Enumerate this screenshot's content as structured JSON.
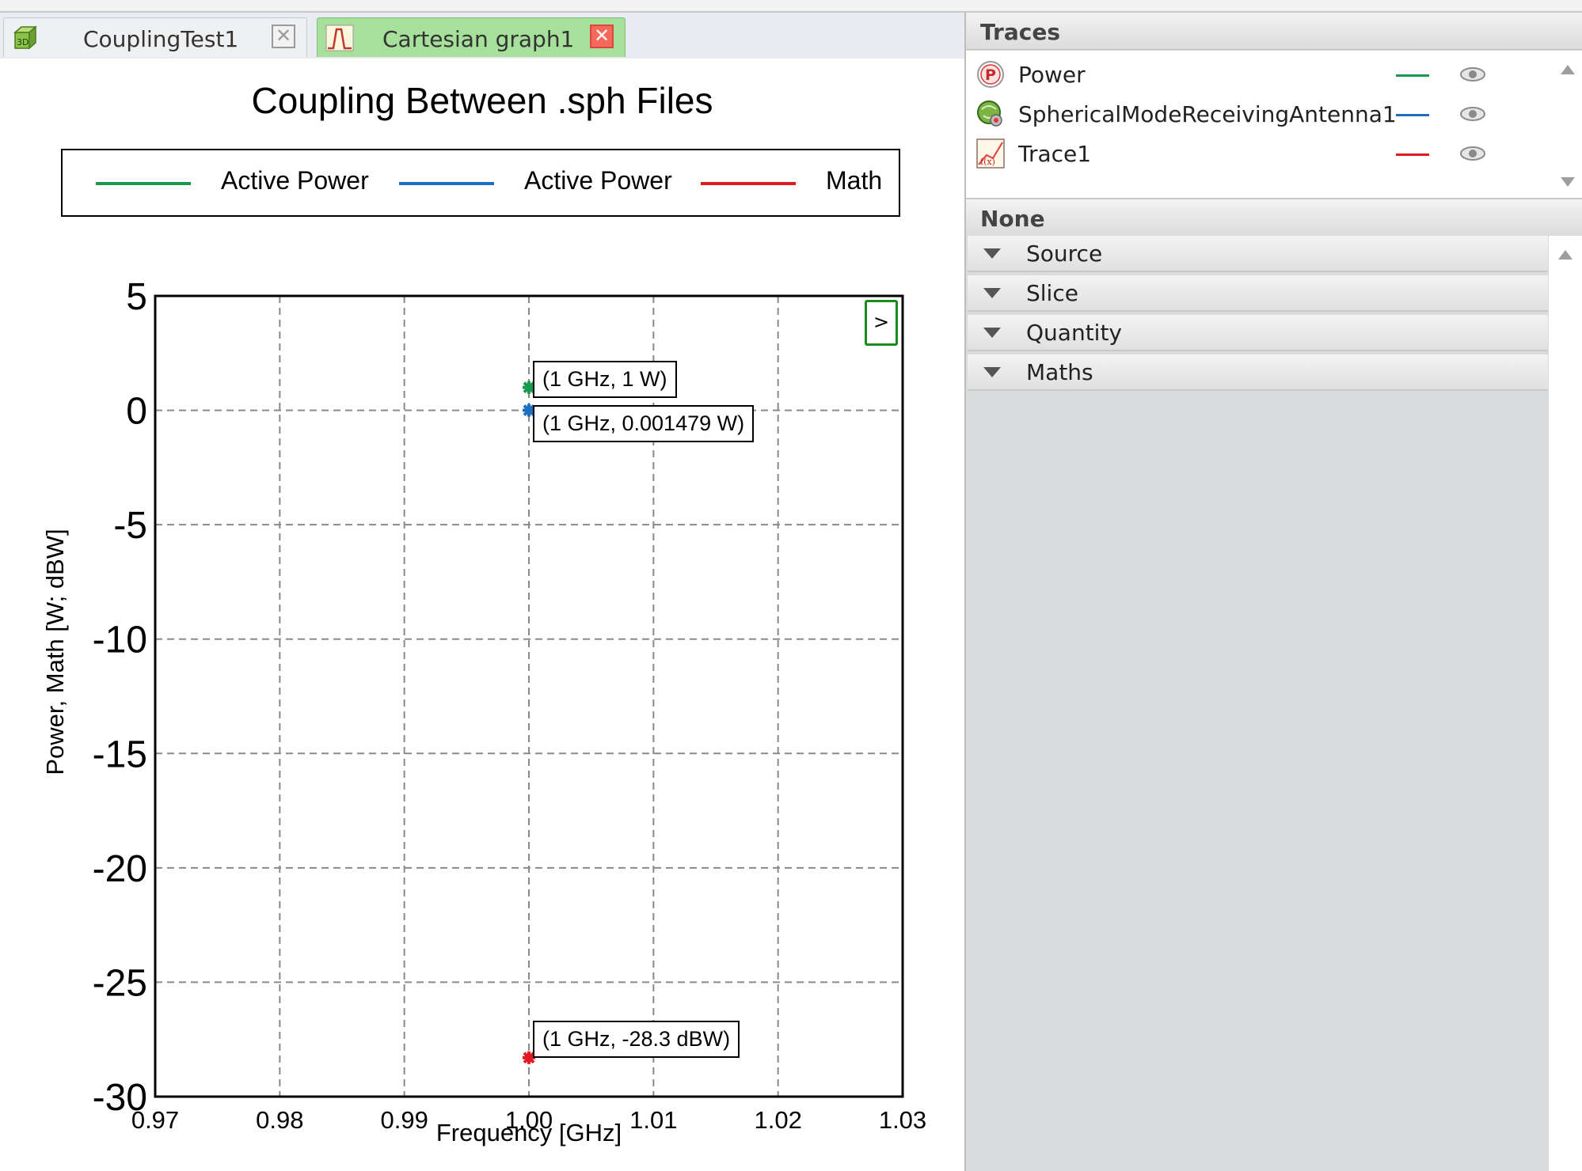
{
  "tabs": [
    {
      "label": "CouplingTest1",
      "icon": "3d-model-icon",
      "icon_text": "3D",
      "active": false
    },
    {
      "label": "Cartesian graph1",
      "icon": "cartesian-graph-icon",
      "active": true
    }
  ],
  "chart": {
    "title": "Coupling Between .sph Files",
    "legend": [
      {
        "label": "Active Power",
        "color": "#1a9a4f"
      },
      {
        "label": "Active Power",
        "color": "#1f6fc0"
      },
      {
        "label": "Math",
        "color": "#e01b24"
      }
    ],
    "expand_button": ">"
  },
  "chart_data": {
    "type": "scatter",
    "title": "Coupling Between .sph Files",
    "xlabel": "Frequency [GHz]",
    "ylabel": "Power, Math [W; dBW]",
    "xlim": [
      0.97,
      1.03
    ],
    "ylim": [
      -30,
      5
    ],
    "xticks": [
      0.97,
      0.98,
      0.99,
      1.0,
      1.01,
      1.02,
      1.03
    ],
    "xtick_labels": [
      "0.97",
      "0.98",
      "0.99",
      "1.00",
      "1.01",
      "1.02",
      "1.03"
    ],
    "yticks": [
      5,
      0,
      -5,
      -10,
      -15,
      -20,
      -25,
      -30
    ],
    "ytick_labels": [
      "5",
      "0",
      "-5",
      "-10",
      "-15",
      "-20",
      "-25",
      "-30"
    ],
    "grid": true,
    "legend_position": "top",
    "series": [
      {
        "name": "Active Power",
        "color": "#1a9a4f",
        "x": [
          1.0
        ],
        "y": [
          1.0
        ],
        "annotation": "(1 GHz, 1 W)"
      },
      {
        "name": "Active Power",
        "color": "#1f6fc0",
        "x": [
          1.0
        ],
        "y": [
          0.001479
        ],
        "annotation": "(1 GHz, 0.001479 W)"
      },
      {
        "name": "Math",
        "color": "#e01b24",
        "x": [
          1.0
        ],
        "y": [
          -28.3
        ],
        "annotation": "(1 GHz, -28.3 dBW)"
      }
    ]
  },
  "traces_panel": {
    "header": "Traces",
    "items": [
      {
        "name": "Power",
        "icon": "power-icon",
        "icon_text": "P",
        "color": "#1a9a4f",
        "eye": "eye-icon"
      },
      {
        "name": "SphericalModeReceivingAntenna1",
        "icon": "antenna-icon",
        "color": "#1f6fc0",
        "eye": "eye-icon"
      },
      {
        "name": "Trace1",
        "icon": "math-trace-icon",
        "icon_text": "f(x)",
        "color": "#e01b24",
        "eye": "eye-icon"
      }
    ]
  },
  "properties_panel": {
    "header": "None",
    "sections": [
      "Source",
      "Slice",
      "Quantity",
      "Maths"
    ]
  }
}
